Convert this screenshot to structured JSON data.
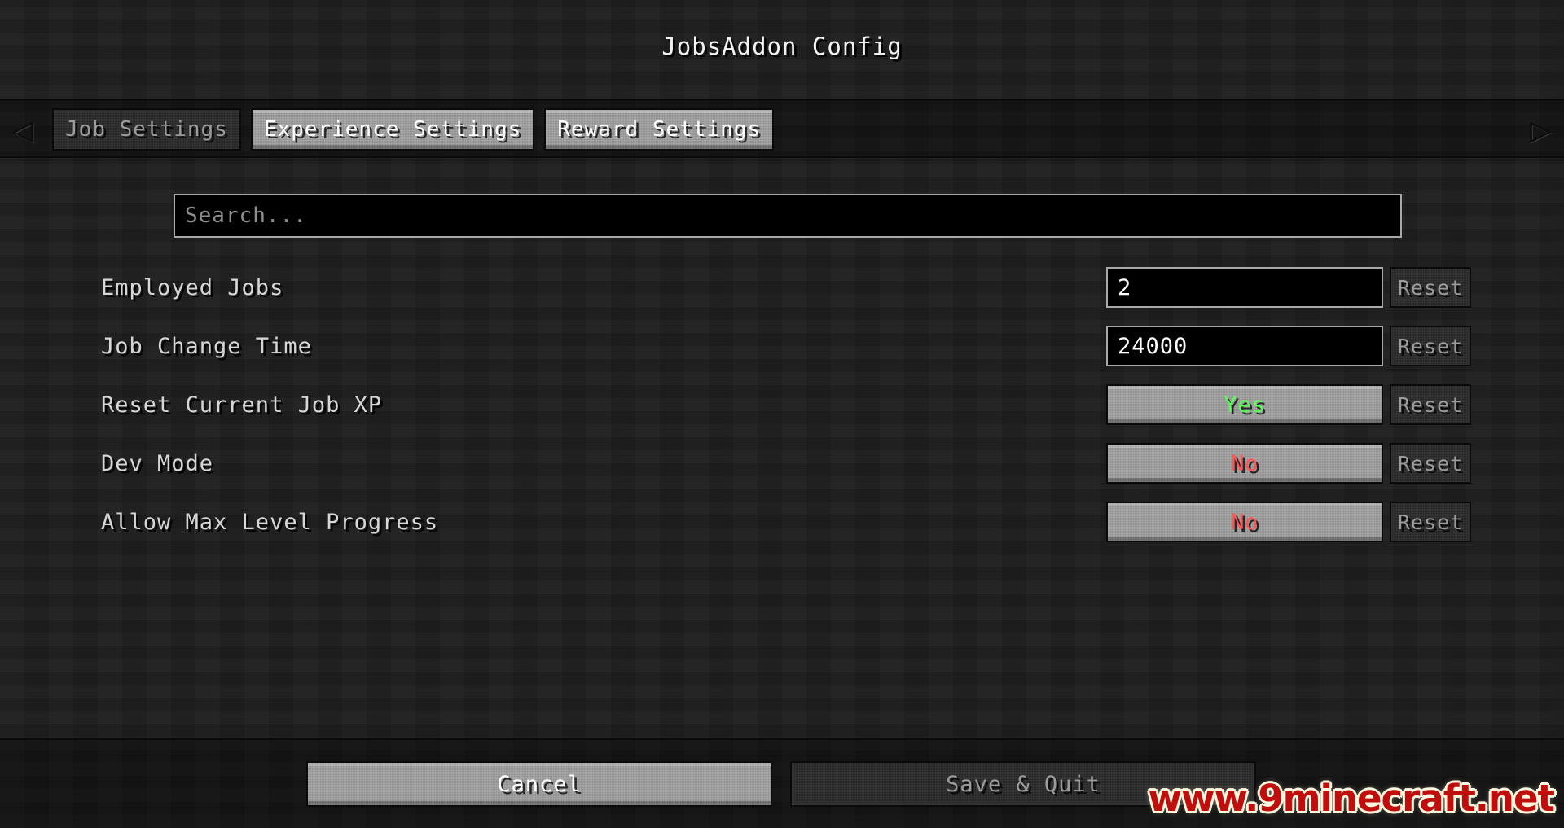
{
  "window": {
    "title": "JobsAddon Config"
  },
  "tabbar": {
    "left_arrow": "◁",
    "right_arrow": "▷",
    "tabs": [
      {
        "label": "Job Settings",
        "state": "disabled"
      },
      {
        "label": "Experience Settings",
        "state": "active"
      },
      {
        "label": "Reward Settings",
        "state": "normal"
      }
    ]
  },
  "search": {
    "placeholder": "Search...",
    "value": ""
  },
  "rows": [
    {
      "label": "Employed Jobs",
      "control_type": "text",
      "value": "2",
      "reset_label": "Reset",
      "reset_enabled": false
    },
    {
      "label": "Job Change Time",
      "control_type": "text",
      "value": "24000",
      "reset_label": "Reset",
      "reset_enabled": false
    },
    {
      "label": "Reset Current Job XP",
      "control_type": "toggle",
      "value": "Yes",
      "value_color": "#55ff55",
      "reset_label": "Reset",
      "reset_enabled": false
    },
    {
      "label": "Dev Mode",
      "control_type": "toggle",
      "value": "No",
      "value_color": "#ff5555",
      "reset_label": "Reset",
      "reset_enabled": false
    },
    {
      "label": "Allow Max Level Progress",
      "control_type": "toggle",
      "value": "No",
      "value_color": "#ff5555",
      "reset_label": "Reset",
      "reset_enabled": false
    }
  ],
  "footer": {
    "cancel_label": "Cancel",
    "save_label": "Save & Quit",
    "save_enabled": false
  },
  "watermark": {
    "text": "www.9minecraft.net"
  },
  "colors": {
    "background": "#1b1b1b",
    "button_face": "#a0a0a0",
    "button_disabled": "#2c2c2c",
    "text_primary": "#ffffff",
    "text_muted": "#9b9b9b",
    "yes_green": "#55ff55",
    "no_red": "#ff5555",
    "watermark_red": "#c00d0d"
  }
}
